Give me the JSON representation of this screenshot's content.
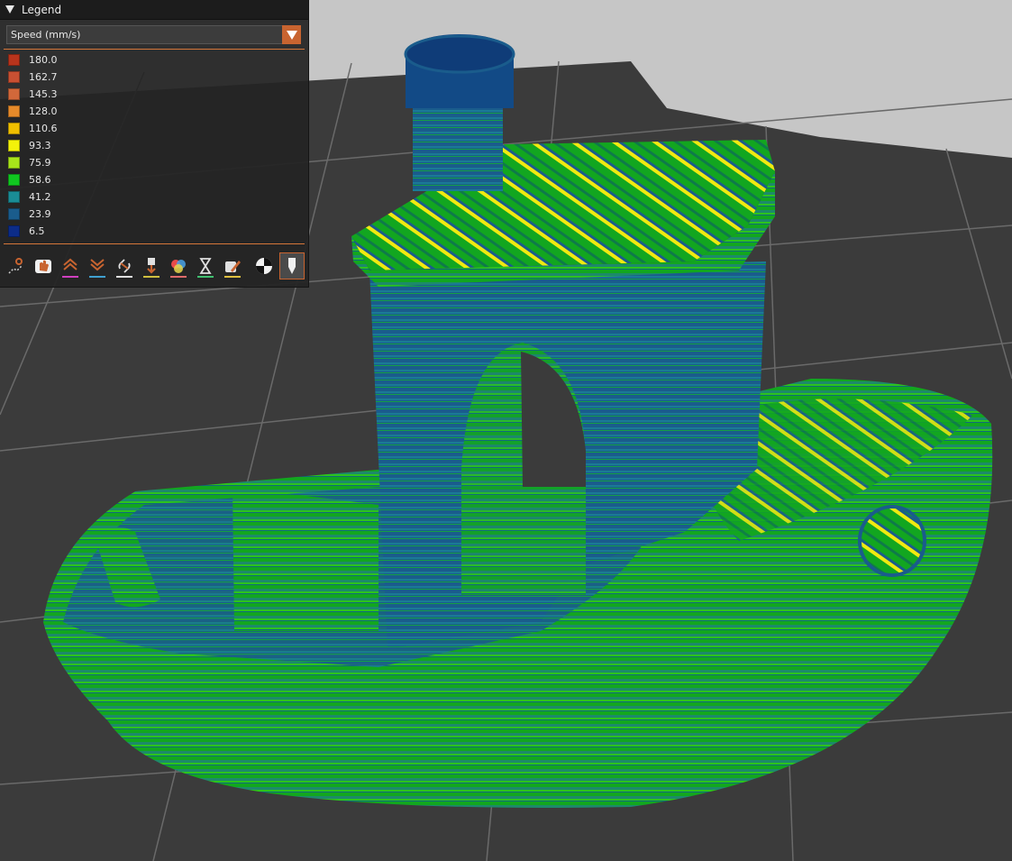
{
  "legend": {
    "title": "Legend",
    "view_type": "Speed (mm/s)",
    "items": [
      {
        "label": "180.0",
        "color": "#b8341c"
      },
      {
        "label": "162.7",
        "color": "#c85032"
      },
      {
        "label": "145.3",
        "color": "#d2683a"
      },
      {
        "label": "128.0",
        "color": "#e68a2a"
      },
      {
        "label": "110.6",
        "color": "#f0c000"
      },
      {
        "label": "93.3",
        "color": "#f4f20a"
      },
      {
        "label": "75.9",
        "color": "#a8e41a"
      },
      {
        "label": "58.6",
        "color": "#10c820"
      },
      {
        "label": "41.2",
        "color": "#1a8c96"
      },
      {
        "label": "23.9",
        "color": "#1a5c8c"
      },
      {
        "label": "6.5",
        "color": "#0c2c88"
      }
    ]
  },
  "toolbar": [
    {
      "name": "travel-icon",
      "accent": "#c86430"
    },
    {
      "name": "wipe-icon",
      "accent": "#c86430"
    },
    {
      "name": "retractions-icon",
      "accent": "#d040c0"
    },
    {
      "name": "deretractions-icon",
      "accent": "#40a0d0"
    },
    {
      "name": "seams-icon",
      "accent": "#e0e0e0"
    },
    {
      "name": "tool-changes-icon",
      "accent": "#d0c040"
    },
    {
      "name": "color-changes-icon",
      "accent": "#e06a6a"
    },
    {
      "name": "pause-prints-icon",
      "accent": "#40c070"
    },
    {
      "name": "custom-gcodes-icon",
      "accent": "#e0c040"
    },
    {
      "name": "center-of-gravity-icon",
      "accent": "#e0e0e0"
    },
    {
      "name": "tool-marker-icon",
      "accent": "#c86430"
    }
  ]
}
